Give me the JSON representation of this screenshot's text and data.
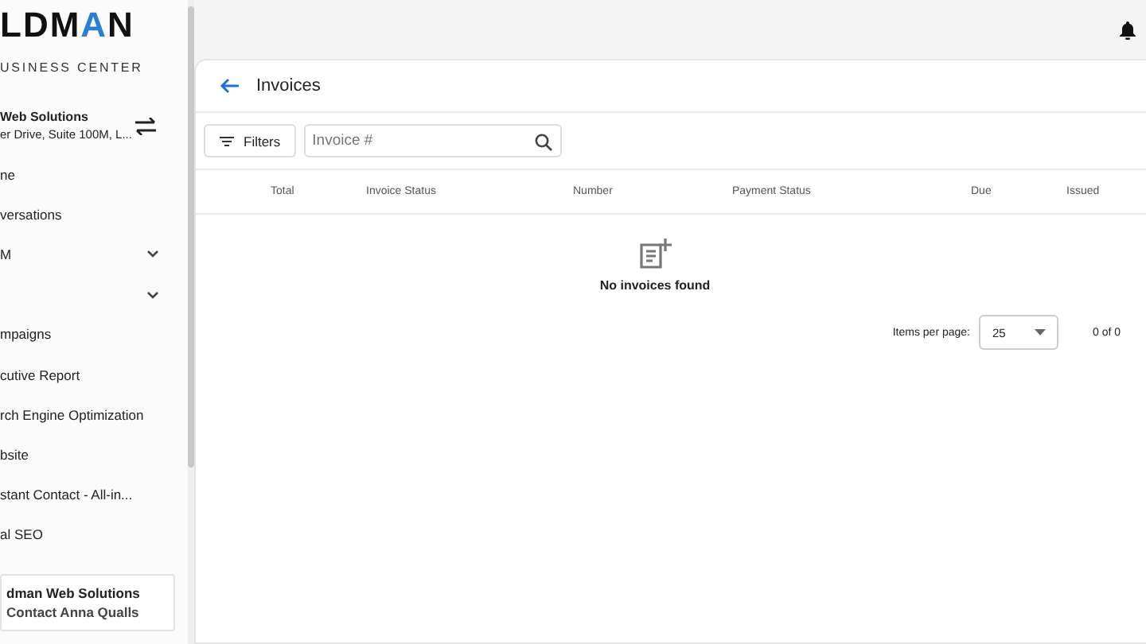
{
  "sidebar": {
    "logo": {
      "prefix": "LDM",
      "accent": "A",
      "suffix": "N"
    },
    "tagline": "USINESS CENTER",
    "account": {
      "name": "Web Solutions",
      "address": "er Drive, Suite 100M, L..."
    },
    "items": [
      {
        "label": "ne",
        "expandable": false
      },
      {
        "label": "versations",
        "expandable": false
      },
      {
        "label": "M",
        "expandable": true
      },
      {
        "expandable": true
      },
      {
        "label": "mpaigns",
        "expandable": false
      },
      {
        "label": "cutive Report",
        "expandable": false
      },
      {
        "label": "rch Engine Optimization",
        "expandable": false
      },
      {
        "label": "bsite",
        "expandable": false
      },
      {
        "label": "stant Contact - All-in...",
        "expandable": false
      },
      {
        "label": "al SEO",
        "expandable": false
      }
    ],
    "footer": {
      "company": "dman Web Solutions",
      "contact": "Contact Anna Qualls"
    }
  },
  "page": {
    "title": "Invoices",
    "filters_button": "Filters",
    "search": {
      "placeholder": "Invoice #"
    },
    "table": {
      "columns": [
        "Total",
        "Invoice Status",
        "Number",
        "Payment Status",
        "Due",
        "Issued"
      ],
      "empty_message": "No invoices found"
    },
    "pagination": {
      "label": "Items per page:",
      "page_size": "25",
      "range": "0 of 0"
    }
  }
}
